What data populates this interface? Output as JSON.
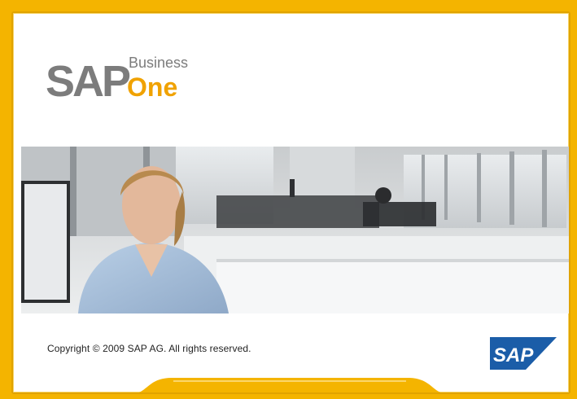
{
  "splash": {
    "logo": {
      "sap_text": "SAP",
      "business_text": "Business",
      "one_text": "One"
    },
    "copyright": "Copyright © 2009 SAP AG. All rights reserved.",
    "corner_logo_text": "SAP",
    "colors": {
      "frame": "#F4B400",
      "panel": "#FFFFFF",
      "logo_gray": "#7C7C7C",
      "logo_orange": "#F0A200",
      "sap_blue": "#1B5DA8"
    }
  }
}
